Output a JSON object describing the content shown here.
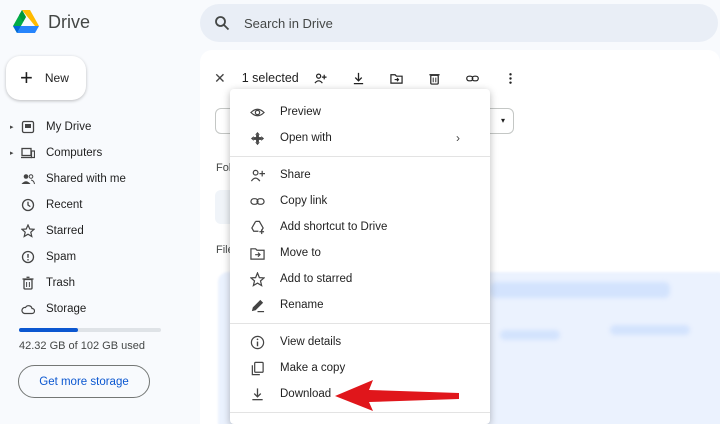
{
  "app": {
    "name": "Drive"
  },
  "search": {
    "placeholder": "Search in Drive"
  },
  "sidebar": {
    "new_label": "New",
    "items": [
      {
        "label": "My Drive",
        "icon": "my-drive-icon"
      },
      {
        "label": "Computers",
        "icon": "computer-icon"
      },
      {
        "label": "Shared with me",
        "icon": "people-icon"
      },
      {
        "label": "Recent",
        "icon": "clock-icon"
      },
      {
        "label": "Starred",
        "icon": "star-icon"
      },
      {
        "label": "Spam",
        "icon": "spam-icon"
      },
      {
        "label": "Trash",
        "icon": "trash-icon"
      },
      {
        "label": "Storage",
        "icon": "cloud-icon"
      }
    ],
    "storage_used_fraction": 0.415,
    "storage_text": "42.32 GB of 102 GB used",
    "get_more_storage": "Get more storage"
  },
  "toolbar": {
    "selected_label": "1 selected",
    "actions": [
      "close-icon",
      "share-icon",
      "download-icon",
      "move-icon",
      "trash-icon",
      "link-icon",
      "more-vert-icon"
    ]
  },
  "main": {
    "folders_partial": "Fol",
    "files_partial": "File"
  },
  "context_menu": {
    "items": [
      {
        "label": "Preview",
        "icon": "eye-icon"
      },
      {
        "label": "Open with",
        "icon": "open-with-icon",
        "submenu": "›"
      },
      {
        "label": "Share",
        "icon": "share-icon"
      },
      {
        "label": "Copy link",
        "icon": "link-icon"
      },
      {
        "label": "Add shortcut to Drive",
        "icon": "shortcut-icon"
      },
      {
        "label": "Move to",
        "icon": "move-icon"
      },
      {
        "label": "Add to starred",
        "icon": "star-icon"
      },
      {
        "label": "Rename",
        "icon": "pencil-icon"
      },
      {
        "label": "View details",
        "icon": "info-icon"
      },
      {
        "label": "Make a copy",
        "icon": "copy-icon"
      },
      {
        "label": "Download",
        "icon": "download-icon"
      }
    ]
  },
  "colors": {
    "accent": "#0b57d0",
    "arrow": "#e0161b",
    "background": "#f8fafd"
  }
}
